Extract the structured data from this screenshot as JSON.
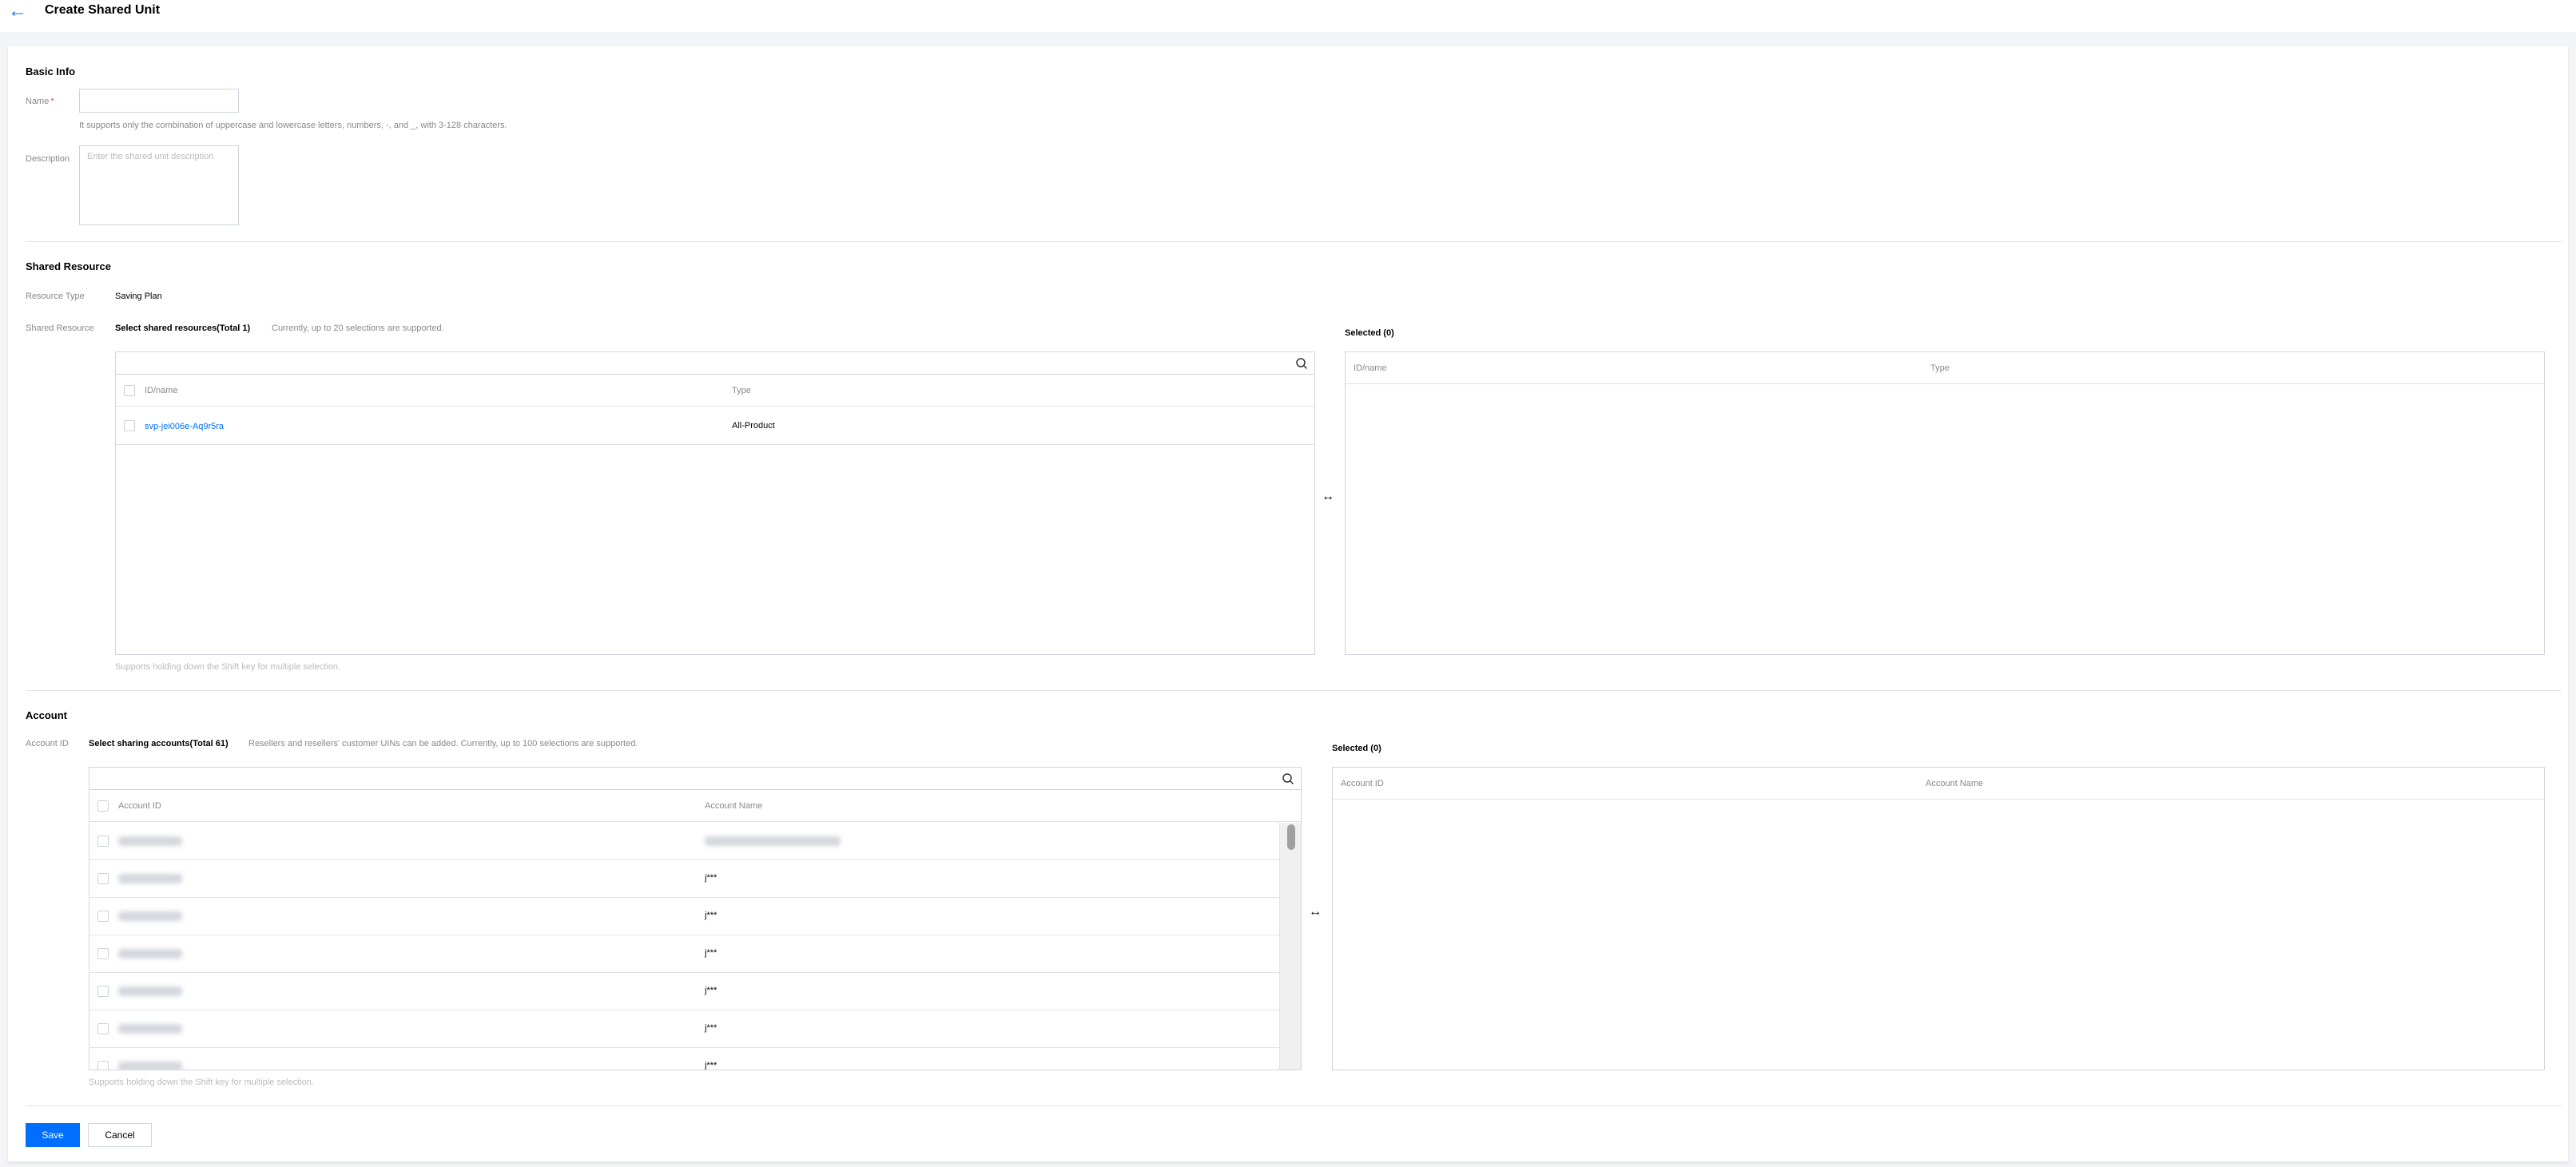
{
  "header": {
    "back_icon": "←",
    "title": "Create Shared Unit"
  },
  "basic_info": {
    "title": "Basic Info",
    "name_label": "Name",
    "required_mark": "*",
    "name_value": "",
    "name_hint": "It supports only the combination of uppercase and lowercase letters, numbers, -, and _, with 3-128 characters.",
    "description_label": "Description",
    "description_placeholder": "Enter the shared unit description"
  },
  "shared_resource": {
    "title": "Shared Resource",
    "resource_type_label": "Resource Type",
    "resource_type_value": "Saving Plan",
    "shared_resource_label": "Shared Resource",
    "select_title": "Select shared resources(Total 1)",
    "select_hint": "Currently, up to 20 selections are supported.",
    "columns": [
      "ID/name",
      "Type"
    ],
    "rows": [
      {
        "id": "svp-jei006e-Aq9r5ra",
        "type": "All-Product"
      }
    ],
    "selected_title": "Selected (0)",
    "selected_columns": [
      "ID/name",
      "Type"
    ],
    "multi_hint": "Supports holding down the Shift key for multiple selection.",
    "swap_icon": "↔"
  },
  "account": {
    "title": "Account",
    "account_id_label": "Account ID",
    "select_title": "Select sharing accounts(Total 61)",
    "select_hint": "Resellers and resellers' customer UINs can be added. Currently, up to 100 selections are supported.",
    "columns": [
      "Account ID",
      "Account Name"
    ],
    "row_names": [
      "",
      "j***",
      "j***",
      "j***",
      "j***",
      "j***",
      "j***"
    ],
    "selected_title": "Selected (0)",
    "selected_columns": [
      "Account ID",
      "Account Name"
    ],
    "multi_hint": "Supports holding down the Shift key for multiple selection.",
    "swap_icon": "↔"
  },
  "footer": {
    "save_label": "Save",
    "cancel_label": "Cancel"
  },
  "colors": {
    "primary": "#006eff",
    "required": "#e54545"
  },
  "icons": {
    "back": "arrow-left-icon",
    "search": "search-icon",
    "swap": "swap-arrows-icon"
  }
}
